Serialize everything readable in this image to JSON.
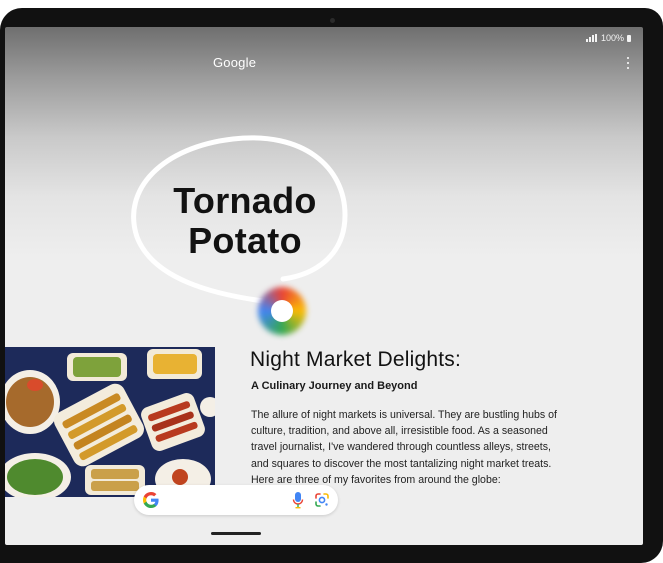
{
  "status_bar": {
    "battery": "100%"
  },
  "app": {
    "title": "Google"
  },
  "selection": {
    "line1": "Tornado",
    "line2": "Potato"
  },
  "article": {
    "title": "Night Market Delights:",
    "subtitle": "A Culinary Journey and Beyond",
    "body": "The allure of night markets is universal. They are bustling hubs of culture, tradition, and above all, irresistible food. As a seasoned travel journalist, I've wandered through countless alleys, streets, and squares to discover the most tantalizing night market treats. Here are three of my favorites from around the globe:"
  },
  "icons": {
    "menu": "more-vert-icon",
    "search_logo": "google-g-icon",
    "mic": "microphone-icon",
    "lens": "google-lens-icon",
    "orb": "circle-to-search-orb"
  },
  "colors": {
    "google_blue": "#4285f4",
    "google_red": "#ea4335",
    "google_yellow": "#fbbc04",
    "google_green": "#34a853"
  }
}
